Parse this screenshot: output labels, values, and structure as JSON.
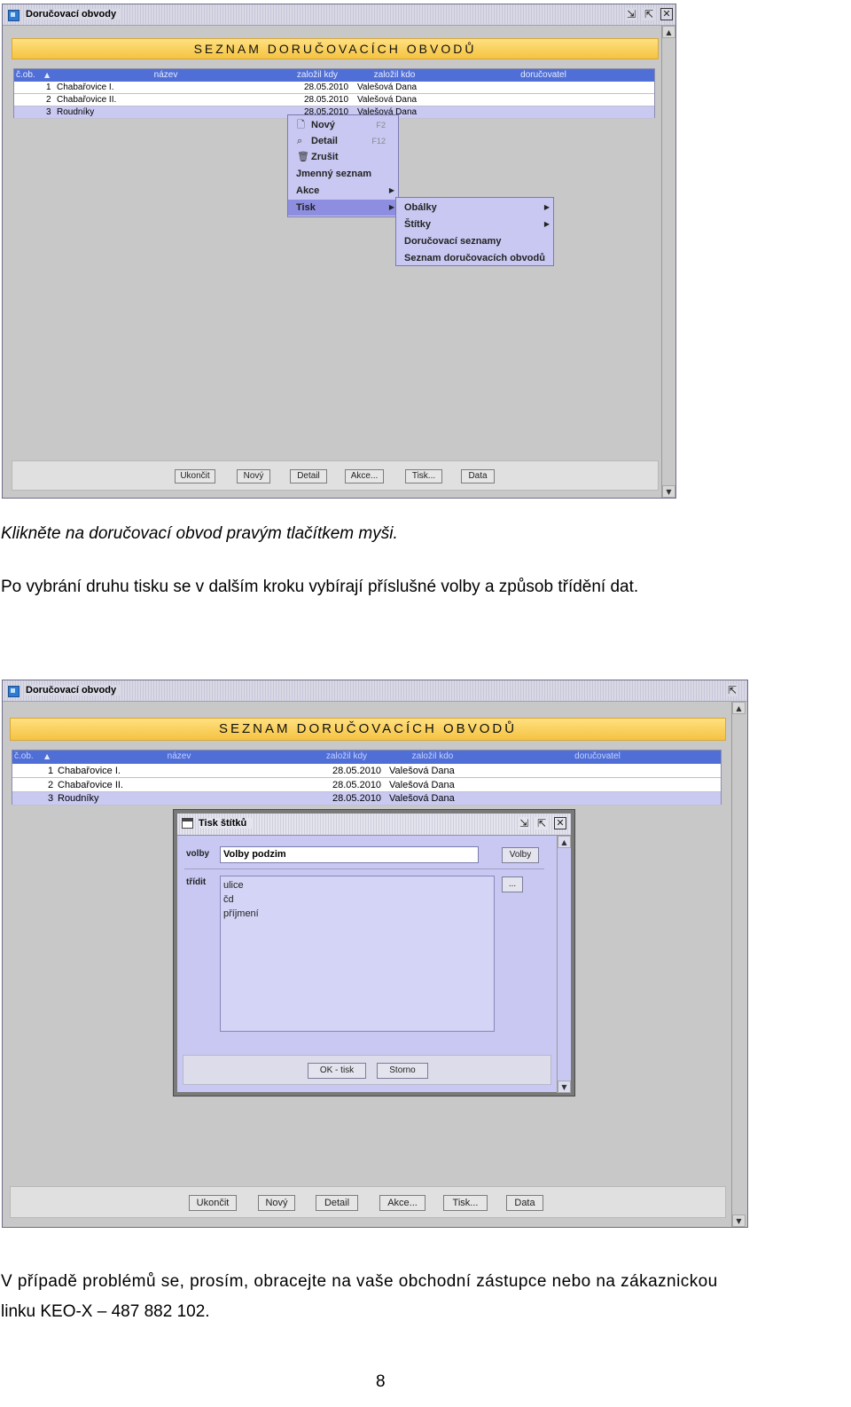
{
  "window1": {
    "title": "Doručovací obvody",
    "header_banner": "SEZNAM DORUČOVACÍCH OBVODŮ",
    "columns": [
      "č.ob.",
      "název",
      "založil kdy",
      "založil kdo",
      "doručovatel"
    ],
    "rows": [
      {
        "num": "1",
        "name": "Chabařovice I.",
        "date": "28.05.2010",
        "user": "Valešová Dana"
      },
      {
        "num": "2",
        "name": "Chabařovice II.",
        "date": "28.05.2010",
        "user": "Valešová Dana"
      },
      {
        "num": "3",
        "name": "Roudníky",
        "date": "28.05.2010",
        "user": "Valešová Dana"
      }
    ],
    "context_menu": [
      {
        "label": "Nový",
        "shortcut": "F2",
        "icon": "new-doc-icon"
      },
      {
        "label": "Detail",
        "shortcut": "F12",
        "icon": "magnifier-icon"
      },
      {
        "label": "Zrušit",
        "shortcut": "",
        "icon": "trash-icon"
      },
      {
        "label": "Jmenný seznam",
        "shortcut": ""
      },
      {
        "label": "Akce",
        "shortcut": ""
      },
      {
        "label": "Tisk",
        "shortcut": ""
      }
    ],
    "submenu": [
      "Obálky",
      "Štítky",
      "Doručovací seznamy",
      "Seznam doručovacích obvodů"
    ],
    "buttons": [
      "Ukončit",
      "Nový",
      "Detail",
      "Akce...",
      "Tisk...",
      "Data"
    ]
  },
  "paragraph1": "Klikněte na doručovací obvod pravým tlačítkem myši.",
  "paragraph2": "Po vybrání druhu tisku se v dalším kroku vybírají příslušné volby a způsob třídění dat.",
  "window2": {
    "title": "Doručovací obvody",
    "header_banner": "SEZNAM DORUČOVACÍCH OBVODŮ",
    "columns": [
      "č.ob.",
      "název",
      "založil kdy",
      "založil kdo",
      "doručovatel"
    ],
    "rows": [
      {
        "num": "1",
        "name": "Chabařovice I.",
        "date": "28.05.2010",
        "user": "Valešová Dana"
      },
      {
        "num": "2",
        "name": "Chabařovice II.",
        "date": "28.05.2010",
        "user": "Valešová Dana"
      },
      {
        "num": "3",
        "name": "Roudníky",
        "date": "28.05.2010",
        "user": "Valešová Dana"
      }
    ],
    "dialog": {
      "title": "Tisk štítků",
      "volby_label": "volby",
      "volby_value": "Volby podzim",
      "volby_button": "Volby",
      "tridit_label": "třídit",
      "tridit_button": "...",
      "sort_items": [
        "ulice",
        "čd",
        "příjmení"
      ],
      "ok_button": "OK - tisk",
      "cancel_button": "Storno"
    },
    "buttons": [
      "Ukončit",
      "Nový",
      "Detail",
      "Akce...",
      "Tisk...",
      "Data"
    ]
  },
  "paragraph3_line1": "V případě problémů se, prosím, obracejte na vaše obchodní zástupce nebo na zákaznickou",
  "paragraph3_line2": "linku  KEO-X – 487 882 102.",
  "page_number": "8"
}
